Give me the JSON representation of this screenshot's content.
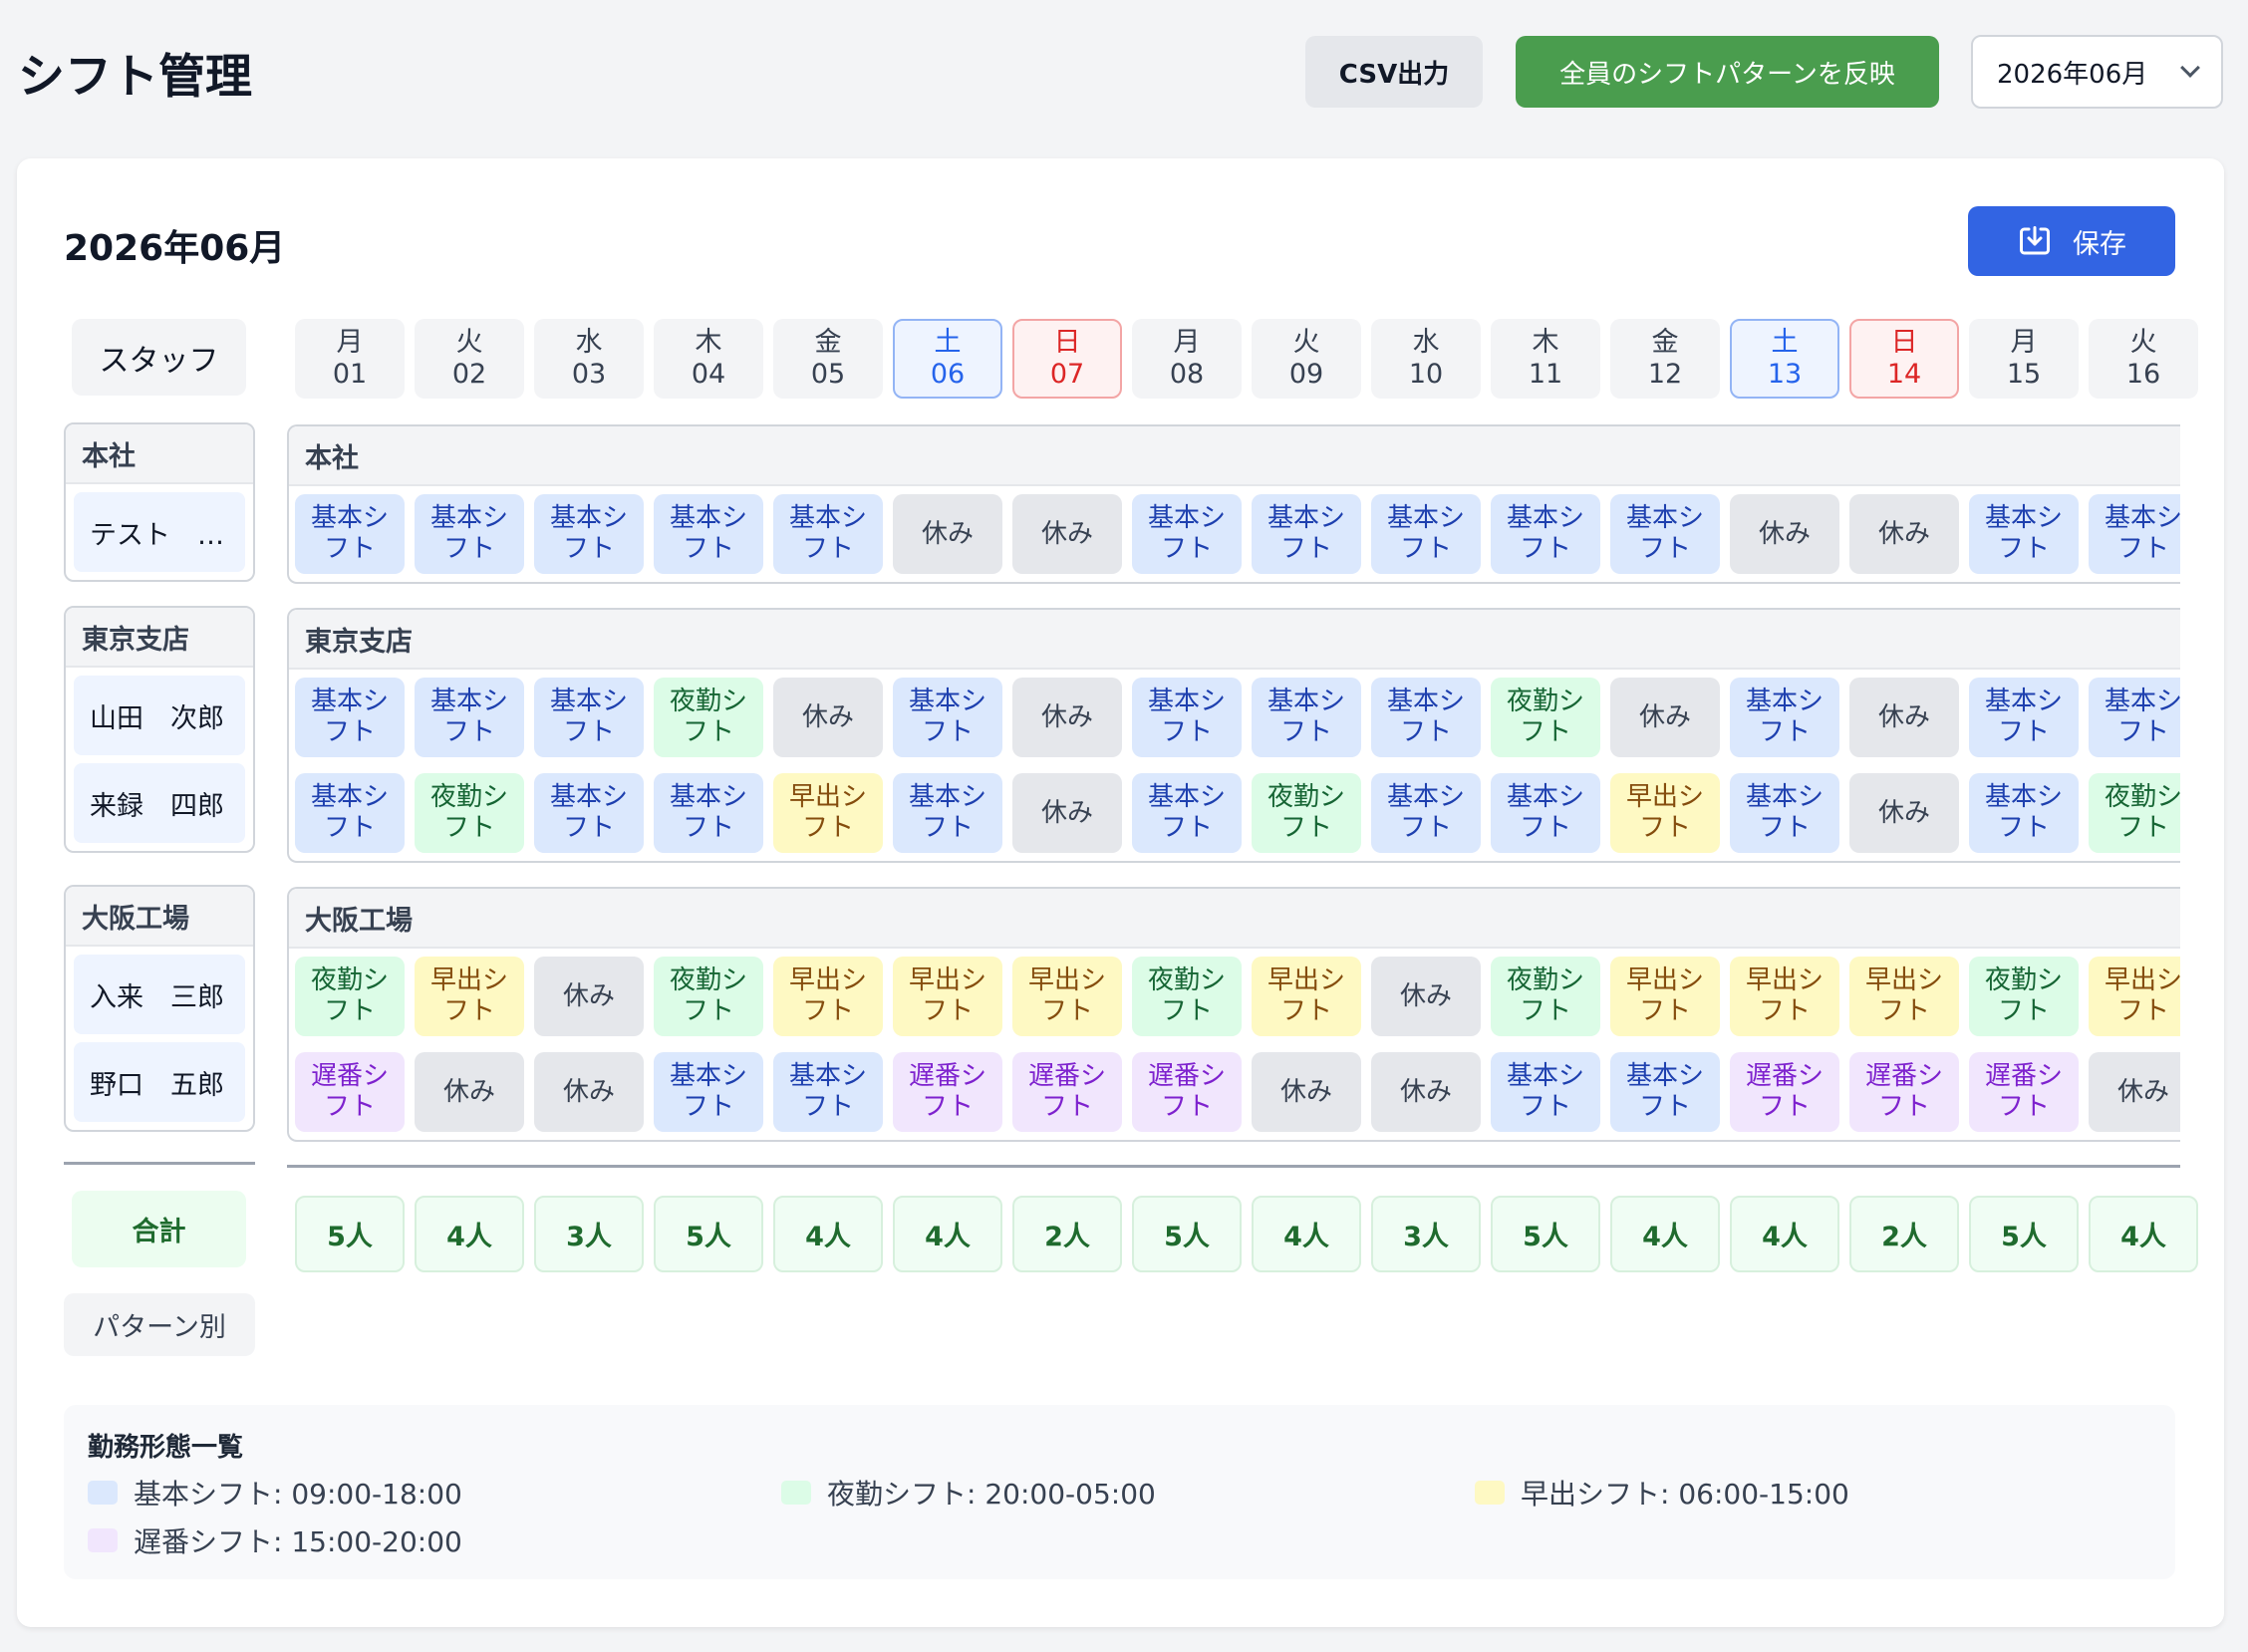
{
  "header": {
    "title": "シフト管理",
    "csv_label": "CSV出力",
    "apply_label": "全員のシフトパターンを反映",
    "month_value": "2026年06月"
  },
  "card": {
    "title": "2026年06月",
    "save_label": "保存"
  },
  "table": {
    "staff_header": "スタッフ",
    "days": [
      {
        "dow": "月",
        "date": "01",
        "type": "weekday"
      },
      {
        "dow": "火",
        "date": "02",
        "type": "weekday"
      },
      {
        "dow": "水",
        "date": "03",
        "type": "weekday"
      },
      {
        "dow": "木",
        "date": "04",
        "type": "weekday"
      },
      {
        "dow": "金",
        "date": "05",
        "type": "weekday"
      },
      {
        "dow": "土",
        "date": "06",
        "type": "sat"
      },
      {
        "dow": "日",
        "date": "07",
        "type": "sun"
      },
      {
        "dow": "月",
        "date": "08",
        "type": "weekday"
      },
      {
        "dow": "火",
        "date": "09",
        "type": "weekday"
      },
      {
        "dow": "水",
        "date": "10",
        "type": "weekday"
      },
      {
        "dow": "木",
        "date": "11",
        "type": "weekday"
      },
      {
        "dow": "金",
        "date": "12",
        "type": "weekday"
      },
      {
        "dow": "土",
        "date": "13",
        "type": "sat"
      },
      {
        "dow": "日",
        "date": "14",
        "type": "sun"
      },
      {
        "dow": "月",
        "date": "15",
        "type": "weekday"
      },
      {
        "dow": "火",
        "date": "16",
        "type": "weekday"
      }
    ],
    "groups": [
      {
        "name": "本社",
        "staff": [
          {
            "name": "テスト　…",
            "shifts": [
              "kihon",
              "kihon",
              "kihon",
              "kihon",
              "kihon",
              "yasumi",
              "yasumi",
              "kihon",
              "kihon",
              "kihon",
              "kihon",
              "kihon",
              "yasumi",
              "yasumi",
              "kihon",
              "kihon"
            ]
          }
        ]
      },
      {
        "name": "東京支店",
        "staff": [
          {
            "name": "山田　次郎",
            "shifts": [
              "kihon",
              "kihon",
              "kihon",
              "yakin",
              "yasumi",
              "kihon",
              "yasumi",
              "kihon",
              "kihon",
              "kihon",
              "yakin",
              "yasumi",
              "kihon",
              "yasumi",
              "kihon",
              "kihon"
            ]
          },
          {
            "name": "来録　四郎",
            "shifts": [
              "kihon",
              "yakin",
              "kihon",
              "kihon",
              "hayade",
              "kihon",
              "yasumi",
              "kihon",
              "yakin",
              "kihon",
              "kihon",
              "hayade",
              "kihon",
              "yasumi",
              "kihon",
              "yakin"
            ]
          }
        ]
      },
      {
        "name": "大阪工場",
        "staff": [
          {
            "name": "入来　三郎",
            "shifts": [
              "yakin",
              "hayade",
              "yasumi",
              "yakin",
              "hayade",
              "hayade",
              "hayade",
              "yakin",
              "hayade",
              "yasumi",
              "yakin",
              "hayade",
              "hayade",
              "hayade",
              "yakin",
              "hayade"
            ]
          },
          {
            "name": "野口　五郎",
            "shifts": [
              "osoban",
              "yasumi",
              "yasumi",
              "kihon",
              "kihon",
              "osoban",
              "osoban",
              "osoban",
              "yasumi",
              "yasumi",
              "kihon",
              "kihon",
              "osoban",
              "osoban",
              "osoban",
              "yasumi"
            ]
          }
        ]
      }
    ],
    "shift_labels": {
      "kihon": "基本シ\nフト",
      "yakin": "夜勤シ\nフト",
      "hayade": "早出シ\nフト",
      "osoban": "遅番シ\nフト",
      "yasumi": "休み"
    },
    "total_label": "合計",
    "totals": [
      "5人",
      "4人",
      "3人",
      "5人",
      "4人",
      "4人",
      "2人",
      "5人",
      "4人",
      "3人",
      "5人",
      "4人",
      "4人",
      "2人",
      "5人",
      "4人"
    ],
    "pattern_label": "パターン別"
  },
  "legend": {
    "title": "勤務形態一覧",
    "items": [
      {
        "label": "基本シフト: 09:00-18:00",
        "color": "#dbe8fd"
      },
      {
        "label": "夜勤シフト: 20:00-05:00",
        "color": "#dcfce7"
      },
      {
        "label": "早出シフト: 06:00-15:00",
        "color": "#fef9c3"
      },
      {
        "label": "遅番シフト: 15:00-20:00",
        "color": "#f1e6fd"
      }
    ]
  }
}
